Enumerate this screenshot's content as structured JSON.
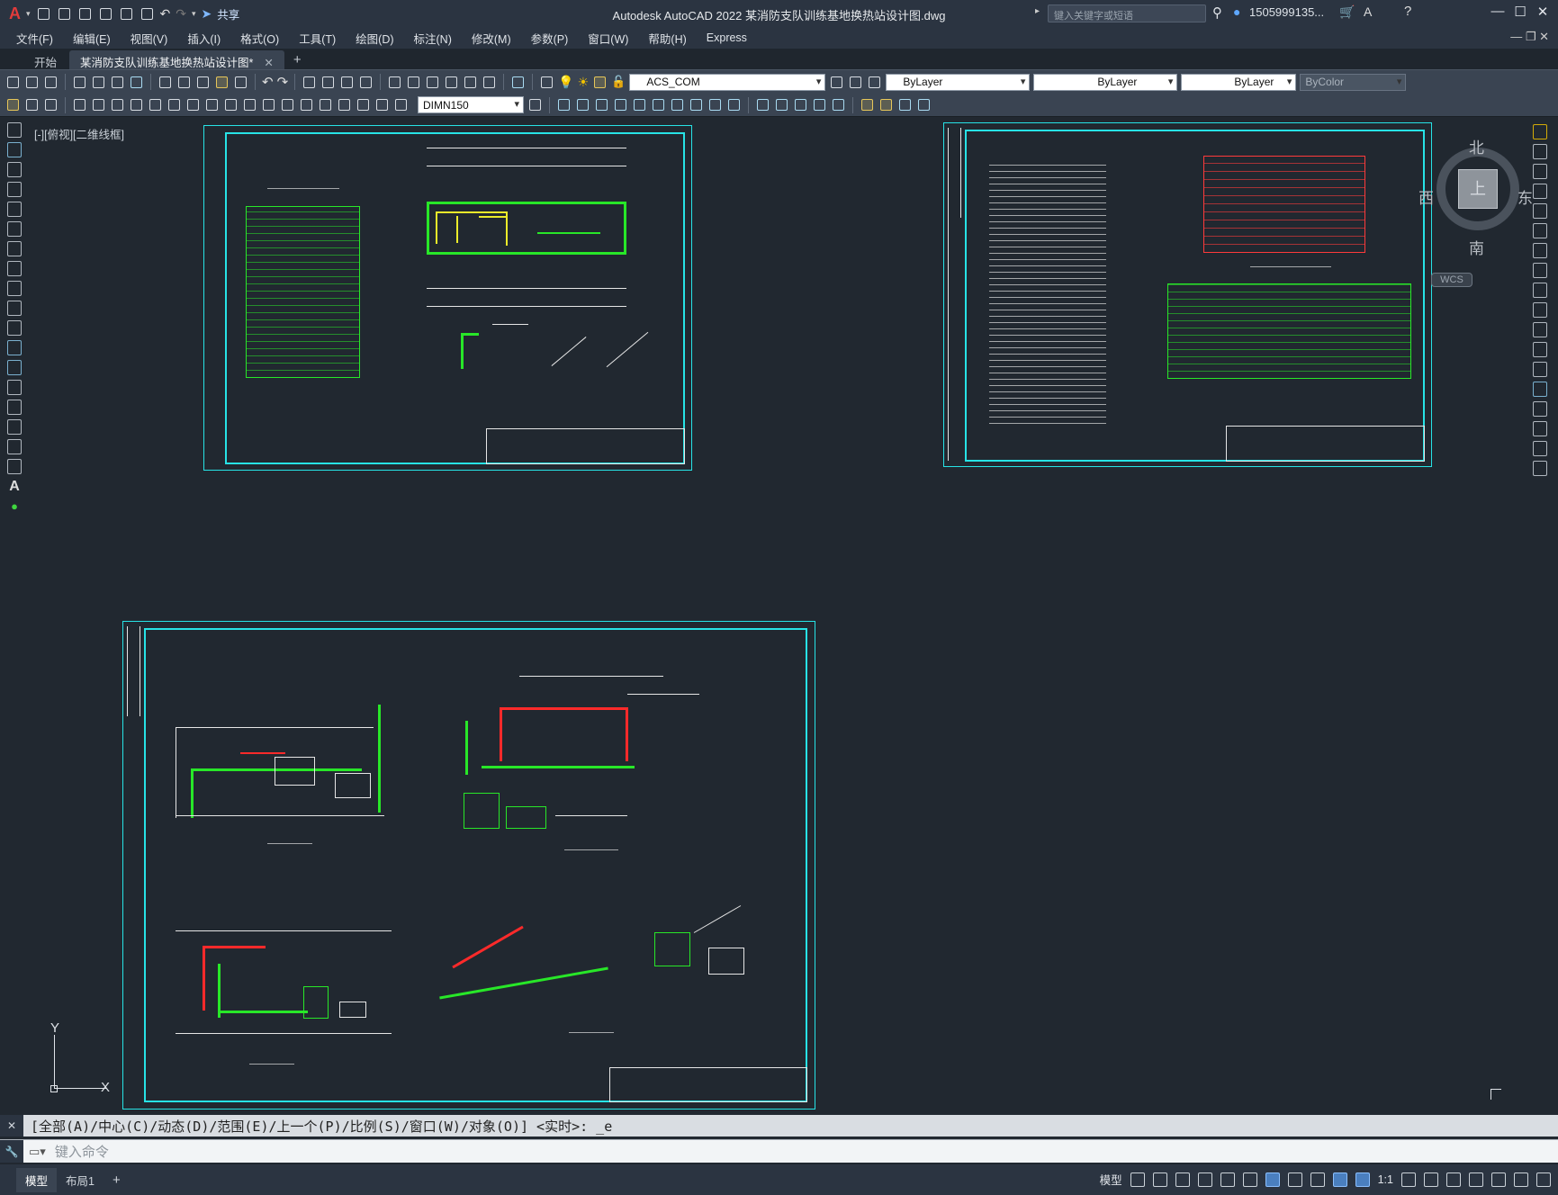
{
  "app": {
    "title": "Autodesk AutoCAD 2022    某消防支队训练基地换热站设计图.dwg",
    "share_label": "共享",
    "search_placeholder": "键入关键字或短语",
    "user": "1505999135...",
    "menus": [
      "文件(F)",
      "编辑(E)",
      "视图(V)",
      "插入(I)",
      "格式(O)",
      "工具(T)",
      "绘图(D)",
      "标注(N)",
      "修改(M)",
      "参数(P)",
      "窗口(W)",
      "帮助(H)",
      "Express"
    ]
  },
  "tabs": [
    {
      "label": "开始"
    },
    {
      "label": "某消防支队训练基地换热站设计图*"
    }
  ],
  "toolbar": {
    "layer_value": "ACS_COM",
    "color_value": "ByLayer",
    "linetype_value": "ByLayer",
    "lineweight_value": "ByLayer",
    "plotstyle_value": "ByColor",
    "dimstyle_value": "DIMN150"
  },
  "viewport": {
    "label": "[-][俯视][二维线框]"
  },
  "viewcube": {
    "north": "北",
    "south": "南",
    "east": "东",
    "west": "西",
    "face": "上",
    "wcs": "WCS"
  },
  "ucs": {
    "x": "X",
    "y": "Y"
  },
  "command": {
    "history": "[全部(A)/中心(C)/动态(D)/范围(E)/上一个(P)/比例(S)/窗口(W)/对象(O)] <实时>: _e",
    "placeholder": "键入命令"
  },
  "status": {
    "layout_tabs": [
      "模型",
      "布局1"
    ],
    "model_label": "模型",
    "scale": "1:1"
  },
  "colors": {
    "bg": "#212830",
    "sheet_border": "#27e3e6",
    "pipe_green": "#28e728",
    "pipe_red": "#ff2a2a",
    "line_white": "#e6e6e6"
  }
}
